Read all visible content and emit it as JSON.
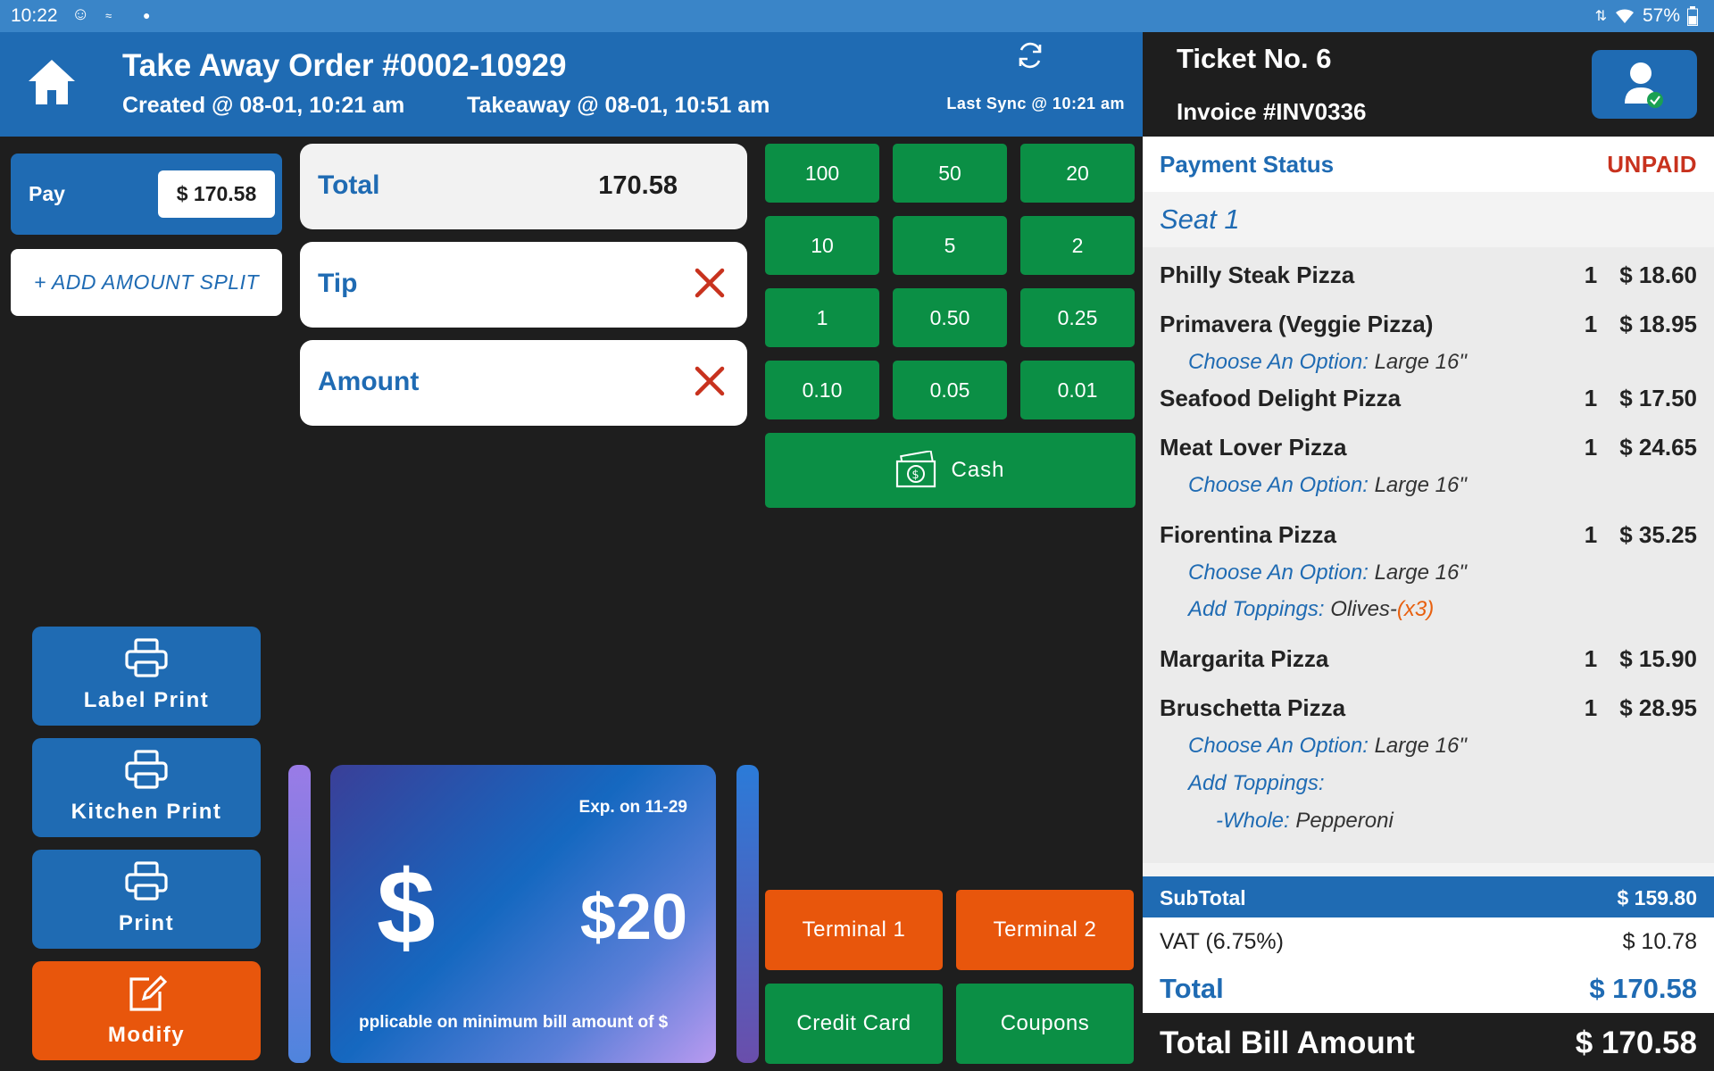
{
  "status_bar": {
    "time": "10:22",
    "battery": "57%"
  },
  "header": {
    "title": "Take Away Order #0002-10929",
    "created": "Created @ 08-01, 10:21 am",
    "takeaway": "Takeaway @ 08-01, 10:51 am",
    "last_sync": "Last Sync @ 10:21 am"
  },
  "ticket_header": {
    "ticket_no": "Ticket No. 6",
    "invoice": "Invoice #INV0336"
  },
  "left": {
    "pay_label": "Pay",
    "pay_amount": "$ 170.58",
    "add_split": "+ ADD AMOUNT SPLIT",
    "label_print": "Label Print",
    "kitchen_print": "Kitchen Print",
    "print": "Print",
    "modify": "Modify"
  },
  "fields": {
    "total_label": "Total",
    "total_value": "170.58",
    "tip_label": "Tip",
    "amount_label": "Amount"
  },
  "keypad": [
    "100",
    "50",
    "20",
    "10",
    "5",
    "2",
    "1",
    "0.50",
    "0.25",
    "0.10",
    "0.05",
    "0.01"
  ],
  "cash_label": "Cash",
  "payment_buttons": {
    "terminal1": "Terminal 1",
    "terminal2": "Terminal 2",
    "credit_card": "Credit Card",
    "coupons": "Coupons"
  },
  "coupon": {
    "expiry": "Exp. on 11-29",
    "symbol": "$",
    "amount": "$20",
    "note": "pplicable on minimum bill amount of $"
  },
  "ticket": {
    "payment_status_label": "Payment Status",
    "payment_status_value": "UNPAID",
    "seat": "Seat 1",
    "items": [
      {
        "name": "Philly Steak Pizza",
        "qty": "1",
        "price": "$ 18.60"
      },
      {
        "name": "Primavera (Veggie Pizza)",
        "qty": "1",
        "price": "$ 18.95",
        "opt_label": "Choose An Option:",
        "opt_value": "Large 16\""
      },
      {
        "name": "Seafood Delight Pizza",
        "qty": "1",
        "price": "$ 17.50"
      },
      {
        "name": "Meat Lover Pizza",
        "qty": "1",
        "price": "$ 24.65",
        "opt_label": "Choose An Option:",
        "opt_value": "Large 16\""
      },
      {
        "name": "Fiorentina Pizza",
        "qty": "1",
        "price": "$ 35.25",
        "opt_label": "Choose An Option:",
        "opt_value": "Large 16\"",
        "top_label": "Add Toppings:",
        "top_value": "Olives-",
        "top_qty": "(x3)"
      },
      {
        "name": "Margarita Pizza",
        "qty": "1",
        "price": "$ 15.90"
      },
      {
        "name": "Bruschetta Pizza",
        "qty": "1",
        "price": "$ 28.95",
        "opt_label": "Choose An Option:",
        "opt_value": "Large 16\"",
        "top_label": "Add Toppings:",
        "whole_label": "-Whole:",
        "whole_value": "Pepperoni"
      }
    ],
    "subtotal_label": "SubTotal",
    "subtotal_value": "$ 159.80",
    "vat_label": "VAT (6.75%)",
    "vat_value": "$ 10.78",
    "total_label": "Total",
    "total_value": "$ 170.58",
    "bill_label": "Total Bill Amount",
    "bill_value": "$ 170.58"
  },
  "colors": {
    "blue": "#1f6bb3",
    "green": "#0b8f45",
    "orange": "#e8560c",
    "unpaid": "#c8321e",
    "dark": "#1e1e1e"
  }
}
